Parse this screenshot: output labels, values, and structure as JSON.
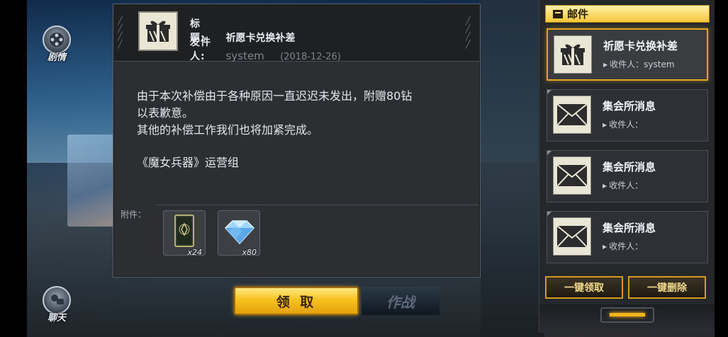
{
  "side": {
    "story_label": "剧情",
    "chat_label": "聊天"
  },
  "mail": {
    "title_key": "标　题:",
    "title_value": "祈愿卡兑换补差",
    "sender_key": "发件人:",
    "sender_value": "system",
    "date": "(2018-12-26)",
    "body_lines": [
      "由于本次补偿由于各种原因一直迟迟未发出，附赠80钻",
      "以表歉意。",
      "其他的补偿工作我们也将加紧完成。"
    ],
    "signature": "《魔女兵器》运营组",
    "attachments_label": "附件：",
    "attachments": [
      {
        "name": "card-icon",
        "count": "x24"
      },
      {
        "name": "diamond-icon",
        "count": "x80"
      }
    ],
    "claim_label": "领 取",
    "battle_label": "作战"
  },
  "list": {
    "title": "邮件",
    "items": [
      {
        "name": "祈愿卡兑换补差",
        "recipient": "收件人：system",
        "icon": "gift-icon",
        "active": true
      },
      {
        "name": "集会所消息",
        "recipient": "收件人：",
        "icon": "envelope-icon",
        "active": false
      },
      {
        "name": "集会所消息",
        "recipient": "收件人：",
        "icon": "envelope-icon",
        "active": false
      },
      {
        "name": "集会所消息",
        "recipient": "收件人：",
        "icon": "envelope-icon",
        "active": false
      }
    ],
    "claim_all_label": "一键领取",
    "delete_all_label": "一键删除"
  },
  "colors": {
    "accent": "#f5b41c",
    "panel": "#2c2e31",
    "claim_button": "#f8c320"
  }
}
